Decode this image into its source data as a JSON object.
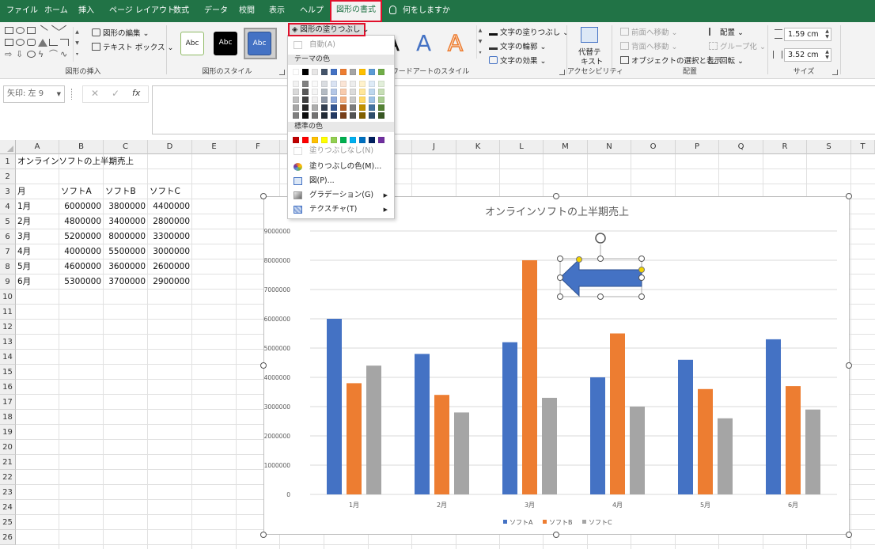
{
  "ribbon": {
    "tabs": [
      "ファイル",
      "ホーム",
      "挿入",
      "ページ レイアウト",
      "数式",
      "データ",
      "校閲",
      "表示",
      "ヘルプ",
      "図形の書式",
      "何をしますか"
    ],
    "active_tab": "図形の書式",
    "insert_shapes": {
      "edit_shape": "図形の編集",
      "text_box": "テキスト ボックス",
      "label": "図形の挿入"
    },
    "shape_styles": {
      "sample_text": "Abc",
      "label": "図形のスタイル"
    },
    "fill_button": "図形の塗りつぶし",
    "wordart": {
      "letter": "A",
      "text_fill": "文字の塗りつぶし",
      "text_outline": "文字の輪郭",
      "text_effects": "文字の効果",
      "label": "ワードアートのスタイル"
    },
    "accessibility": {
      "alt_text_line1": "代替テ",
      "alt_text_line2": "キスト",
      "label": "アクセシビリティ"
    },
    "arrange": {
      "bring_forward": "前面へ移動",
      "send_backward": "背面へ移動",
      "selection_pane": "オブジェクトの選択と表示",
      "align": "配置",
      "group": "グループ化",
      "rotate": "回転",
      "label": "配置"
    },
    "size": {
      "height": "1.59 cm",
      "width": "3.52 cm",
      "label": "サイズ"
    }
  },
  "formula_bar": {
    "name_box": "矢印: 左 9",
    "cancel": "✕",
    "enter": "✓",
    "fx": "fx",
    "content": ""
  },
  "grid": {
    "columns": [
      "A",
      "B",
      "C",
      "D",
      "E",
      "F",
      "G",
      "H",
      "I",
      "J",
      "K",
      "L",
      "M",
      "N",
      "O",
      "P",
      "Q",
      "R",
      "S",
      "T"
    ],
    "rows": [
      "1",
      "2",
      "3",
      "4",
      "5",
      "6",
      "7",
      "8",
      "9",
      "10",
      "11",
      "12",
      "13",
      "14",
      "15",
      "16",
      "17",
      "18",
      "19",
      "20",
      "21",
      "22",
      "23",
      "24",
      "25",
      "26"
    ],
    "title": "オンラインソフトの上半期売上",
    "headers": [
      "月",
      "ソフトA",
      "ソフトB",
      "ソフトC"
    ],
    "data": [
      [
        "1月",
        "6000000",
        "3800000",
        "4400000"
      ],
      [
        "2月",
        "4800000",
        "3400000",
        "2800000"
      ],
      [
        "3月",
        "5200000",
        "8000000",
        "3300000"
      ],
      [
        "4月",
        "4000000",
        "5500000",
        "3000000"
      ],
      [
        "5月",
        "4600000",
        "3600000",
        "2600000"
      ],
      [
        "6月",
        "5300000",
        "3700000",
        "2900000"
      ]
    ]
  },
  "chart_data": {
    "type": "bar",
    "title": "オンラインソフトの上半期売上",
    "categories": [
      "1月",
      "2月",
      "3月",
      "4月",
      "5月",
      "6月"
    ],
    "series": [
      {
        "name": "ソフトA",
        "color": "#4472c4",
        "values": [
          6000000,
          4800000,
          5200000,
          4000000,
          4600000,
          5300000
        ]
      },
      {
        "name": "ソフトB",
        "color": "#ed7d31",
        "values": [
          3800000,
          3400000,
          8000000,
          5500000,
          3600000,
          3700000
        ]
      },
      {
        "name": "ソフトC",
        "color": "#a5a5a5",
        "values": [
          4400000,
          2800000,
          3300000,
          3000000,
          2600000,
          2900000
        ]
      }
    ],
    "ylim": [
      0,
      9000000
    ],
    "yticks": [
      "0",
      "1000000",
      "2000000",
      "3000000",
      "4000000",
      "5000000",
      "6000000",
      "7000000",
      "8000000",
      "9000000"
    ],
    "xlabel": "",
    "ylabel": "",
    "grid": true,
    "legend": "bottom"
  },
  "fill_menu": {
    "auto": "自動(A)",
    "theme_colors_label": "テーマの色",
    "standard_colors_label": "標準の色",
    "no_fill": "塗りつぶしなし(N)",
    "more_colors": "塗りつぶしの色(M)...",
    "picture": "図(P)...",
    "gradient": "グラデーション(G)",
    "texture": "テクスチャ(T)",
    "theme_base": [
      "#ffffff",
      "#000000",
      "#e7e6e6",
      "#44546a",
      "#4472c4",
      "#ed7d31",
      "#a5a5a5",
      "#ffc000",
      "#5b9bd5",
      "#70ad47"
    ],
    "standard": [
      "#c00000",
      "#ff0000",
      "#ffc000",
      "#ffff00",
      "#92d050",
      "#00b050",
      "#00b0f0",
      "#0070c0",
      "#002060",
      "#7030a0"
    ]
  }
}
